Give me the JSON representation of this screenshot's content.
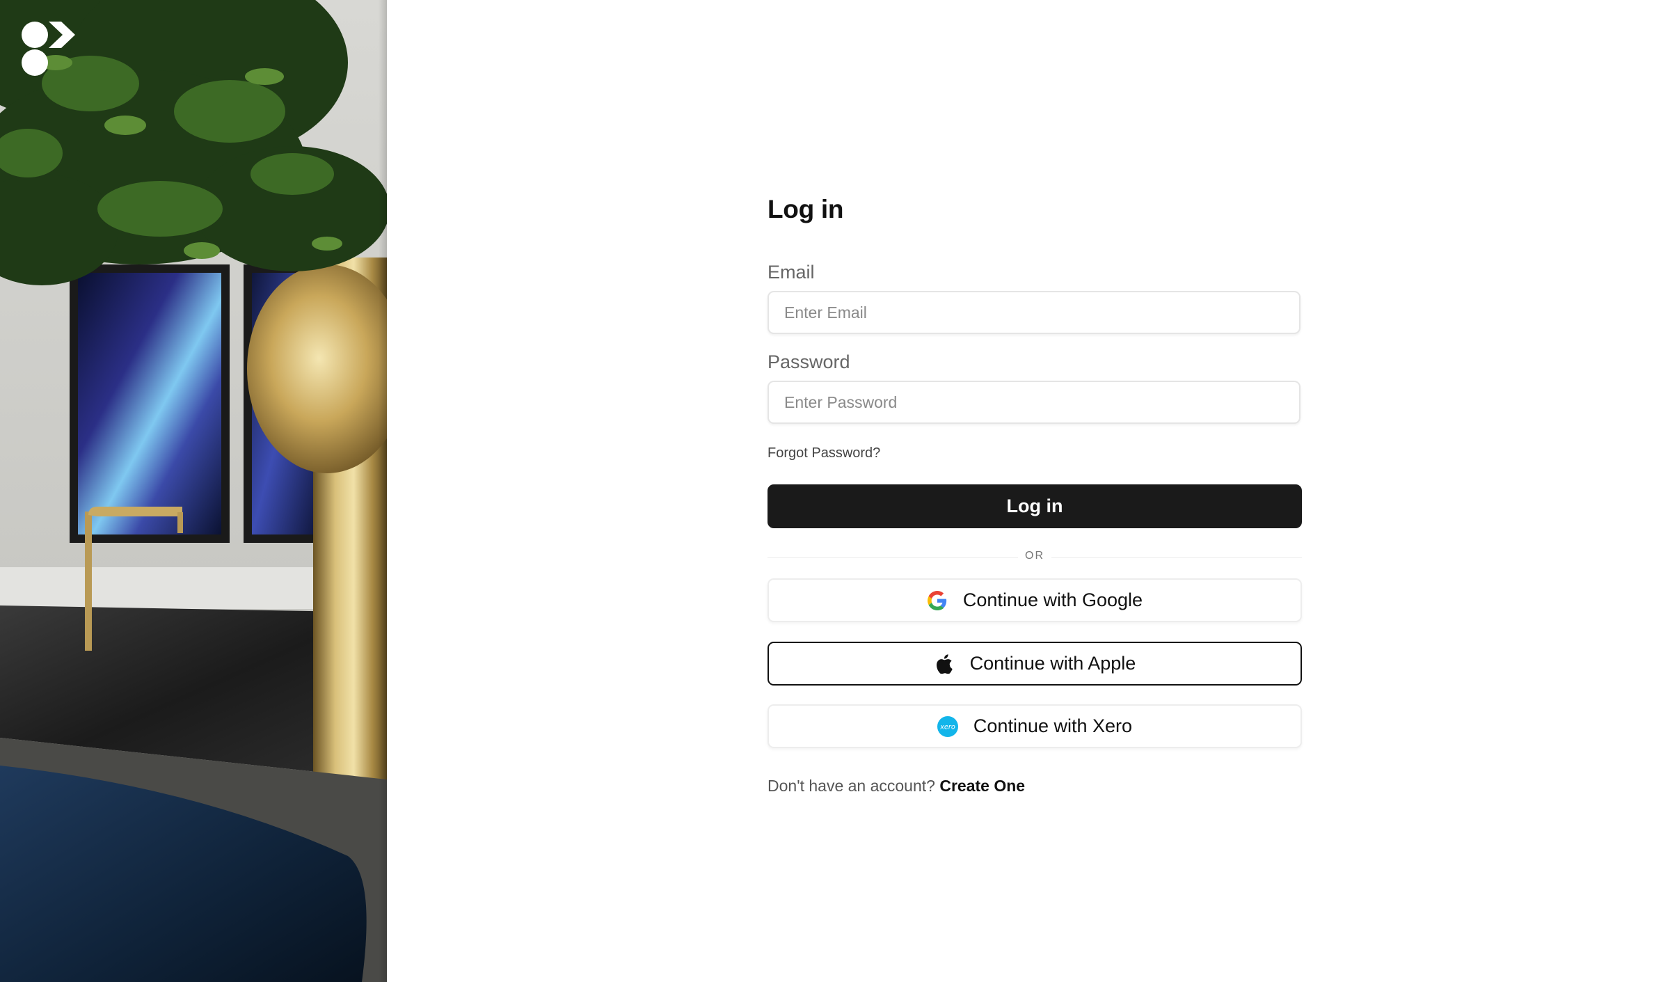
{
  "brand": {
    "logo_icon": "brand-logo-icon"
  },
  "hero": {
    "image": "interior-photo"
  },
  "login": {
    "title": "Log in",
    "email_label": "Email",
    "email_placeholder": "Enter Email",
    "email_value": "",
    "password_label": "Password",
    "password_placeholder": "Enter Password",
    "password_value": "",
    "forgot_label": "Forgot Password?",
    "submit_label": "Log in",
    "divider_label": "OR"
  },
  "social": {
    "google_label": "Continue with Google",
    "google_icon": "google-icon",
    "apple_label": "Continue with Apple",
    "apple_icon": "apple-icon",
    "xero_label": "Continue with Xero",
    "xero_icon": "xero-icon"
  },
  "signup": {
    "prompt": "Don't have an account?",
    "link_label": "Create One"
  },
  "colors": {
    "primary_button": "#1a1a1a",
    "xero_brand": "#13b5ea",
    "input_border": "#e5e5e5"
  }
}
